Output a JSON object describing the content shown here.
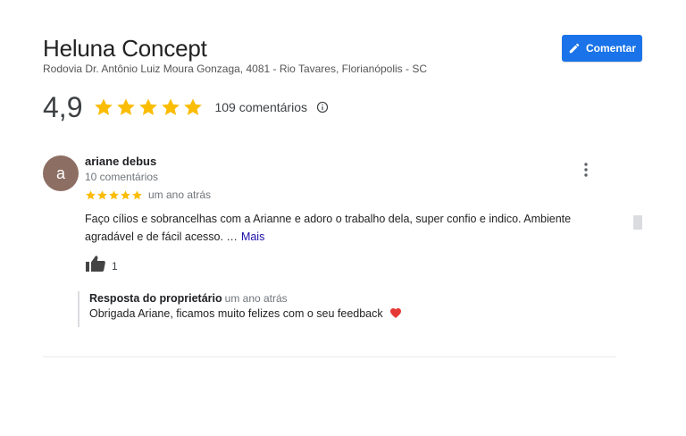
{
  "business": {
    "name": "Heluna Concept",
    "address": "Rodovia Dr. Antônio Luiz Moura Gonzaga, 4081 - Rio Tavares, Florianópolis - SC"
  },
  "actions": {
    "comment_label": "Comentar"
  },
  "rating": {
    "value": "4,9",
    "stars": 5,
    "count_label": "109 comentários"
  },
  "review": {
    "avatar_letter": "a",
    "author": "ariane debus",
    "author_comments": "10 comentários",
    "stars": 5,
    "date": "um ano atrás",
    "text": "Faço cílios e sobrancelhas com a Arianne e adoro o trabalho dela, super confio e indico. Ambiente agradável e de fácil acesso. …",
    "more_label": "Mais",
    "likes": "1",
    "reply": {
      "author": "Resposta do proprietário",
      "date": "um ano atrás",
      "text": "Obrigada Ariane, ficamos muito felizes com o seu feedback"
    }
  },
  "colors": {
    "accent": "#1a73e8",
    "star": "#fbbc04",
    "avatar": "#8d6e63",
    "heart": "#e53935",
    "link": "#1a0dab"
  },
  "icons": [
    "pencil-icon",
    "star-icon",
    "info-icon",
    "more-vert-icon",
    "thumbs-up-icon",
    "heart-icon"
  ]
}
